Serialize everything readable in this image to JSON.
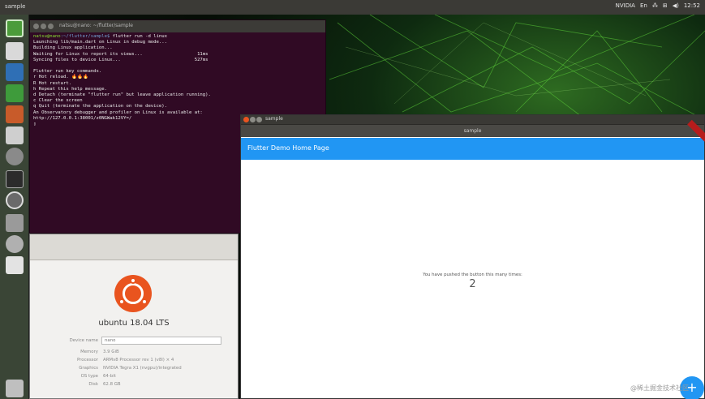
{
  "topbar": {
    "title": "sample",
    "indicators": [
      "NVIDIA",
      "En",
      "⁂",
      "⊞",
      "◀)",
      "12:52"
    ]
  },
  "terminal": {
    "title": "natsu@nano: ~/flutter/sample",
    "prompt_user": "natsu@nano",
    "prompt_path": ":~/flutter/sample$",
    "command": " flutter run -d linux",
    "lines": [
      "Launching lib/main.dart on Linux in debug mode...",
      "Building Linux application...",
      "Waiting for Linux to report its views...                    11ms",
      "Syncing files to device Linux...                           527ms",
      "",
      "Flutter run key commands.",
      "r Hot reload. 🔥🔥🔥",
      "R Hot restart.",
      "h Repeat this help message.",
      "d Detach (terminate \"flutter run\" but leave application running).",
      "c Clear the screen",
      "q Quit (terminate the application on the device).",
      "An Observatory debugger and profiler on Linux is available at:",
      "http://127.0.0.1:38001/z0NGWak12VY=/",
      "▯"
    ]
  },
  "about": {
    "os_name": "ubuntu 18.04 LTS",
    "device_label": "Device name",
    "device_value": "nano",
    "rows": [
      {
        "label": "Memory",
        "value": "3.9 GiB"
      },
      {
        "label": "Processor",
        "value": "ARMv8 Processor rev 1 (v8l) × 4"
      },
      {
        "label": "Graphics",
        "value": "NVIDIA Tegra X1 (nvgpu)/integrated"
      },
      {
        "label": "OS type",
        "value": "64-bit"
      },
      {
        "label": "Disk",
        "value": "62.8 GB"
      }
    ]
  },
  "flutter": {
    "window_title": "sample",
    "inner_title": "sample",
    "appbar_title": "Flutter Demo Home Page",
    "message": "You have pushed the button this many times:",
    "counter": "2",
    "fab_label": "+"
  },
  "watermark": "@稀土掘金技术社区",
  "colors": {
    "terminal_bg": "#300a24",
    "appbar": "#2196f3",
    "ubuntu_orange": "#e9541f",
    "panel": "#3b3a36"
  }
}
